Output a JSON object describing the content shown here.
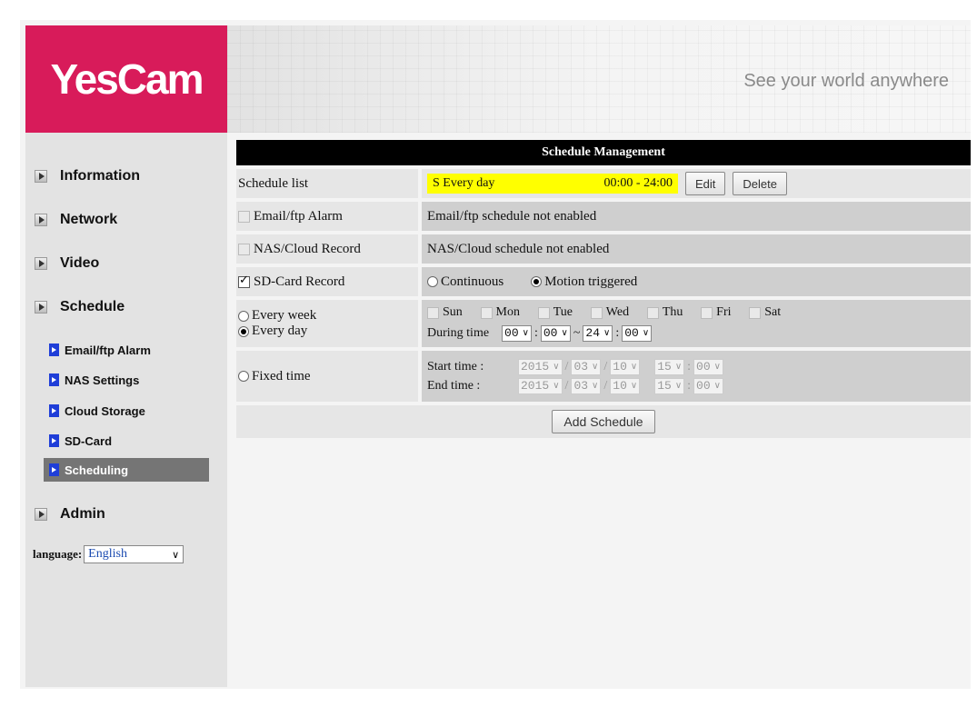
{
  "brand": {
    "logo": "YesCam",
    "tagline": "See your world anywhere"
  },
  "sidebar": {
    "main_items": [
      {
        "label": "Information"
      },
      {
        "label": "Network"
      },
      {
        "label": "Video"
      },
      {
        "label": "Schedule"
      },
      {
        "label": "Admin"
      }
    ],
    "sub_items": [
      {
        "label": "Email/ftp Alarm"
      },
      {
        "label": "NAS Settings"
      },
      {
        "label": "Cloud Storage"
      },
      {
        "label": "SD-Card"
      },
      {
        "label": "Scheduling",
        "active": true
      }
    ],
    "language_label": "language:",
    "language_value": "English"
  },
  "main": {
    "title": "Schedule Management",
    "schedule_list": {
      "label": "Schedule list",
      "item_name": "S Every day",
      "item_time": "00:00 - 24:00",
      "edit_label": "Edit",
      "delete_label": "Delete"
    },
    "email_alarm": {
      "label": "Email/ftp Alarm",
      "status": "Email/ftp schedule not enabled",
      "checked": false
    },
    "nas_record": {
      "label": "NAS/Cloud Record",
      "status": "NAS/Cloud schedule not enabled",
      "checked": false
    },
    "sd_record": {
      "label": "SD-Card Record",
      "checked": true,
      "option_continuous": "Continuous",
      "option_motion": "Motion triggered",
      "selected": "Motion triggered"
    },
    "repeat": {
      "every_week_label": "Every week",
      "every_day_label": "Every day",
      "selected": "Every day",
      "days": [
        "Sun",
        "Mon",
        "Tue",
        "Wed",
        "Thu",
        "Fri",
        "Sat"
      ],
      "during_time_label": "During time",
      "start_hour": "00",
      "start_min": "00",
      "end_hour": "24",
      "end_min": "00"
    },
    "fixed_time": {
      "label": "Fixed time",
      "start_label": "Start time :",
      "end_label": "End time :",
      "start": {
        "year": "2015",
        "month": "03",
        "day": "10",
        "hour": "15",
        "min": "00"
      },
      "end": {
        "year": "2015",
        "month": "03",
        "day": "10",
        "hour": "15",
        "min": "00"
      }
    },
    "add_button_label": "Add Schedule"
  },
  "colors": {
    "brand": "#d81b5a",
    "title_bar": "#000000",
    "schedule_highlight": "#ffff00",
    "active_nav": "#757575",
    "sub_icon": "#1f3ed8"
  }
}
